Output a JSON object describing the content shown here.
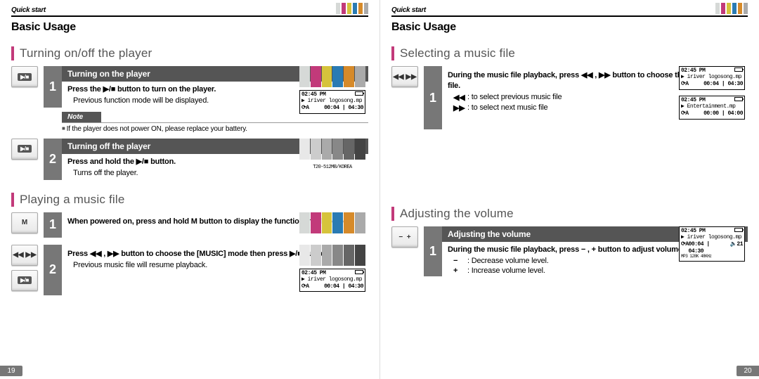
{
  "header": {
    "quick_start": "Quick start",
    "basic_usage": "Basic Usage"
  },
  "left": {
    "section1_title": "Turning on/off the player",
    "step1": {
      "num": "1",
      "bar": "Turning on the player",
      "text": "Press the  ▶/■  button to turn on the player.",
      "sub": "Previous function mode will be displayed."
    },
    "note_label": "Note",
    "note_text": "If the player does not power ON, please replace your battery.",
    "step2": {
      "num": "2",
      "bar": "Turning off the player",
      "text": "Press and hold the  ▶/■  button.",
      "sub": "Turns off the player."
    },
    "section2_title": "Playing a music file",
    "play1": {
      "num": "1",
      "text": "When powered on, press and hold  M  button to display the function mode screen."
    },
    "play2": {
      "num": "2",
      "text": "Press  ◀◀ ,  ▶▶  button to choose the [MUSIC] mode then press  ▶/■  button.",
      "sub": "Previous music file will resume playback."
    },
    "lcd_model": "T20-512MB/KOREA",
    "page_num": "19"
  },
  "right": {
    "section1_title": "Selecting a music file",
    "sel1": {
      "num": "1",
      "text": "During the music file playback, press  ◀◀ ,  ▶▶  button to choose the desired music file.",
      "li1_sym": "◀◀",
      "li1": ": to select previous music file",
      "li2_sym": "▶▶",
      "li2": ": to select next music file"
    },
    "section2_title": "Adjusting the volume",
    "vol1": {
      "num": "1",
      "bar": "Adjusting the volume",
      "text": "During the music file playback, press  − ,  +  button to adjust volume level.",
      "li1_sym": "−",
      "li1": ": Decrease volume level.",
      "li2_sym": "+",
      "li2": ": Increase volume level."
    },
    "page_num": "20"
  },
  "lcd": {
    "time": "02:45 PM",
    "song1": "iriver logosong.mp",
    "song2": "Entertainment.mp",
    "elapsed1": "00:04 | 04:30",
    "elapsed2": "00:00 | 04:00",
    "meta": "MP3  128K  48KHz",
    "vol": "21",
    "a": "A"
  }
}
